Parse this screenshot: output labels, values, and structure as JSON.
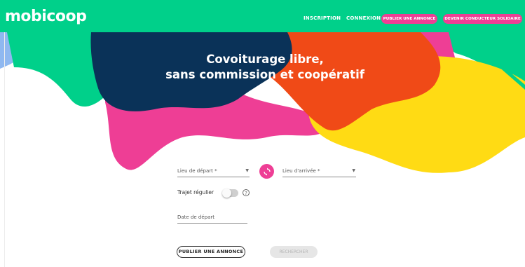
{
  "brand": {
    "name": "mobicoop"
  },
  "nav": {
    "inscription": "INSCRIPTION",
    "connexion": "CONNEXION",
    "publier": "PUBLIER UNE ANNONCE",
    "conducteur": "DEVENIR CONDUCTEUR SOLIDAIRE"
  },
  "hero": {
    "line1": "Covoiturage libre,",
    "line2": "sans commission et coopératif"
  },
  "form": {
    "depart_label": "Lieu de départ *",
    "arrivee_label": "Lieu d'arrivée *",
    "regular_label": "Trajet régulier",
    "regular_on": false,
    "help_symbol": "?",
    "date_label": "Date de départ",
    "publish_button": "PUBLIER UNE ANNONCE",
    "search_button": "RECHERCHER"
  },
  "colors": {
    "brand_green": "#00d08a",
    "pink": "#ee3e95",
    "navy": "#0a3258",
    "orange": "#f04a17",
    "yellow": "#ffdb14"
  }
}
